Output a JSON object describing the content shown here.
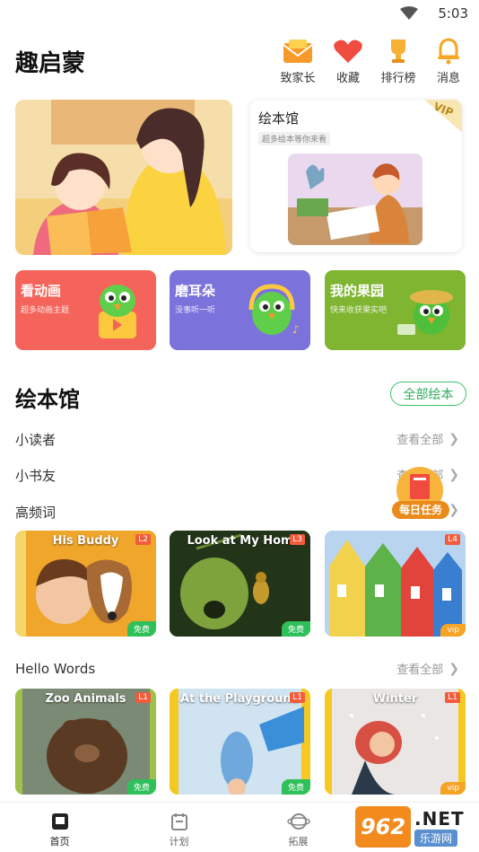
{
  "status_bar": {
    "time": "5:03",
    "wifi_icon": "wifi-icon"
  },
  "header": {
    "title": "趣启蒙",
    "actions": [
      {
        "label": "致家长",
        "icon": "envelope-icon"
      },
      {
        "label": "收藏",
        "icon": "heart-icon"
      },
      {
        "label": "排行榜",
        "icon": "trophy-icon"
      },
      {
        "label": "消息",
        "icon": "bell-icon"
      }
    ]
  },
  "hero": {
    "left_image": "mother-child-reading-illustration",
    "right": {
      "title": "绘本馆",
      "subtitle": "超多绘本等你来看",
      "ribbon": "VIP"
    }
  },
  "categories": [
    {
      "title": "看动画",
      "subtitle": "超多动画主题",
      "color": "#f5645a"
    },
    {
      "title": "磨耳朵",
      "subtitle": "没事听一听",
      "color": "#7b72dc"
    },
    {
      "title": "我的果园",
      "subtitle": "快来收获果实吧",
      "color": "#7fb531"
    }
  ],
  "picture_books": {
    "title": "绘本馆",
    "all_button": "全部绘本",
    "rows": [
      {
        "label": "小读者",
        "view_all": "查看全部"
      },
      {
        "label": "小书友",
        "view_all": "查看全部"
      },
      {
        "label": "高频词",
        "view_all": ""
      }
    ],
    "daily_task": "每日任务",
    "books_row1": [
      {
        "title": "His Buddy",
        "level": "L2",
        "badge": "免费"
      },
      {
        "title": "Look at My Hom",
        "level": "L3",
        "badge": "免费"
      },
      {
        "title": "",
        "level": "L4",
        "badge": "vip"
      }
    ]
  },
  "hello_words": {
    "label": "Hello Words",
    "view_all": "查看全部",
    "books": [
      {
        "title": "Zoo Animals",
        "level": "L1",
        "badge": "免费"
      },
      {
        "title": "At the Playground",
        "level": "L1",
        "badge": "免费"
      },
      {
        "title": "Winter",
        "level": "L1",
        "badge": "vip"
      }
    ]
  },
  "bottom_nav": [
    {
      "label": "首页",
      "icon": "home-book-icon",
      "active": true
    },
    {
      "label": "计划",
      "icon": "calendar-icon",
      "active": false
    },
    {
      "label": "拓展",
      "icon": "planet-icon",
      "active": false
    }
  ],
  "watermark": {
    "logo": "962",
    "net": ".NET",
    "cn": "乐游网"
  }
}
